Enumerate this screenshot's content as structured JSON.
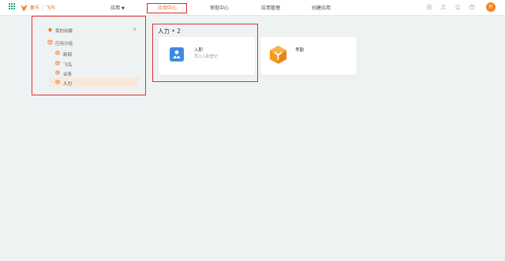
{
  "header": {
    "brand_name": "集号",
    "brand_product": "飞鸟",
    "nav": [
      {
        "label": "应用",
        "has_dropdown": true
      },
      {
        "label": "应用中心",
        "active": true
      },
      {
        "label": "审批中心"
      },
      {
        "label": "应用管理"
      },
      {
        "label": "创建应用"
      }
    ],
    "right_icons": [
      "settings-icon",
      "user-icon",
      "bell-icon",
      "help-icon"
    ],
    "avatar_text": "帅"
  },
  "sidebar": {
    "favorites": {
      "label": "我的收藏",
      "count": "0",
      "icon": "star-icon"
    },
    "apps_group": {
      "label": "应用分组",
      "icon": "cube-icon"
    },
    "groups": [
      {
        "label": "新闻"
      },
      {
        "label": "飞鸟"
      },
      {
        "label": "业务"
      },
      {
        "label": "人力",
        "selected": true
      }
    ]
  },
  "main": {
    "section_title": "人力 • 2",
    "apps": [
      {
        "name": "入职",
        "description": "员工入职登记",
        "icon": "onboarding-icon"
      },
      {
        "name": "考勤",
        "description": "",
        "icon": "attendance-icon"
      }
    ]
  },
  "colors": {
    "accent": "#ef6b14",
    "highlight_frame": "#e03131",
    "grid_icon": "#2aa56c",
    "onboarding_icon_bg": "#3f8bdb",
    "attendance_icon": "#f59a1b",
    "selected_bg": "#f7e9dc",
    "page_bg": "#eff2f2"
  }
}
